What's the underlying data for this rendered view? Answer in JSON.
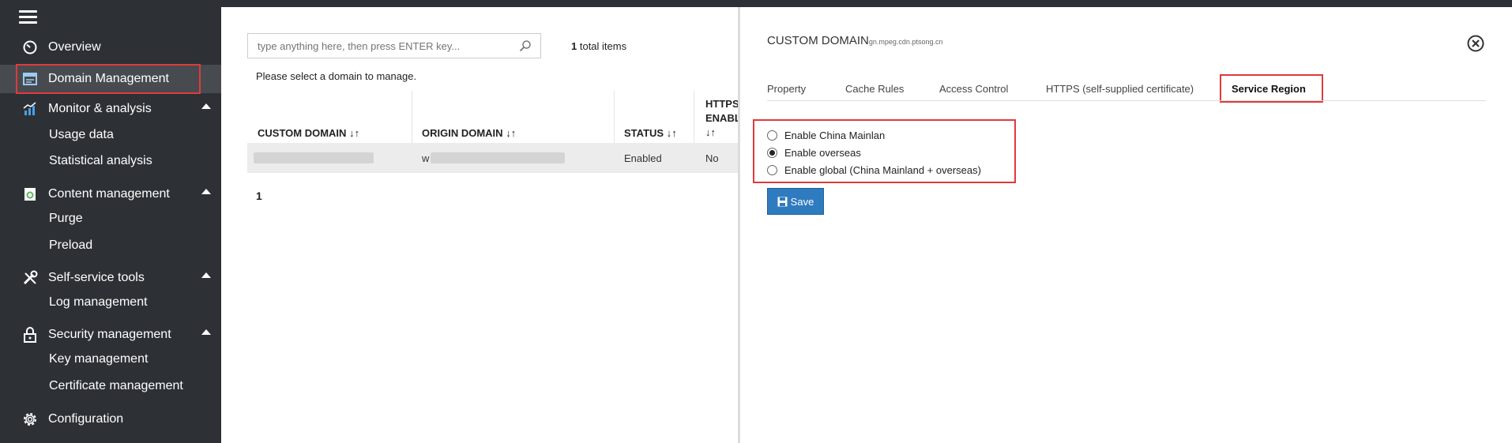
{
  "sidebar": {
    "items": [
      {
        "label": "Overview",
        "icon": "speedometer-icon"
      },
      {
        "label": "Domain Management",
        "icon": "browser-window-icon"
      },
      {
        "label": "Monitor & analysis",
        "icon": "bar-chart-icon"
      },
      {
        "label": "Content management",
        "icon": "document-refresh-icon"
      },
      {
        "label": "Self-service tools",
        "icon": "wrench-icon"
      },
      {
        "label": "Security management",
        "icon": "lock-icon"
      },
      {
        "label": "Configuration",
        "icon": "gear-icon"
      }
    ],
    "sub_items": {
      "usage_data": "Usage data",
      "statistical_analysis": "Statistical analysis",
      "purge": "Purge",
      "preload": "Preload",
      "log_management": "Log management",
      "key_management": "Key management",
      "certificate_management": "Certificate management"
    }
  },
  "list": {
    "search_placeholder": "type anything here, then press ENTER key...",
    "total_count": "1",
    "total_label": " total items",
    "hint": "Please select a domain to manage.",
    "columns": [
      "CUSTOM DOMAIN",
      "ORIGIN DOMAIN",
      "STATUS",
      "HTTPS",
      "ENABL"
    ],
    "row": {
      "origin_prefix": "w",
      "status": "Enabled",
      "https": "No"
    },
    "page": "1"
  },
  "panel": {
    "title": "CUSTOM DOMAIN",
    "subtitle": "gn.mpeg.cdn.ptsong.cn",
    "tabs": [
      "Property",
      "Cache Rules",
      "Access Control",
      "HTTPS (self-supplied certificate)",
      "Service Region"
    ],
    "active_tab": "Service Region",
    "options": [
      {
        "label": "Enable China Mainlan",
        "checked": false
      },
      {
        "label": "Enable overseas",
        "checked": true
      },
      {
        "label": "Enable global (China Mainland + overseas)",
        "checked": false
      }
    ],
    "save_label": "Save"
  },
  "colors": {
    "sidebar_bg": "#2d3136",
    "highlight": "#e03a3a",
    "button": "#2f7bbf"
  }
}
